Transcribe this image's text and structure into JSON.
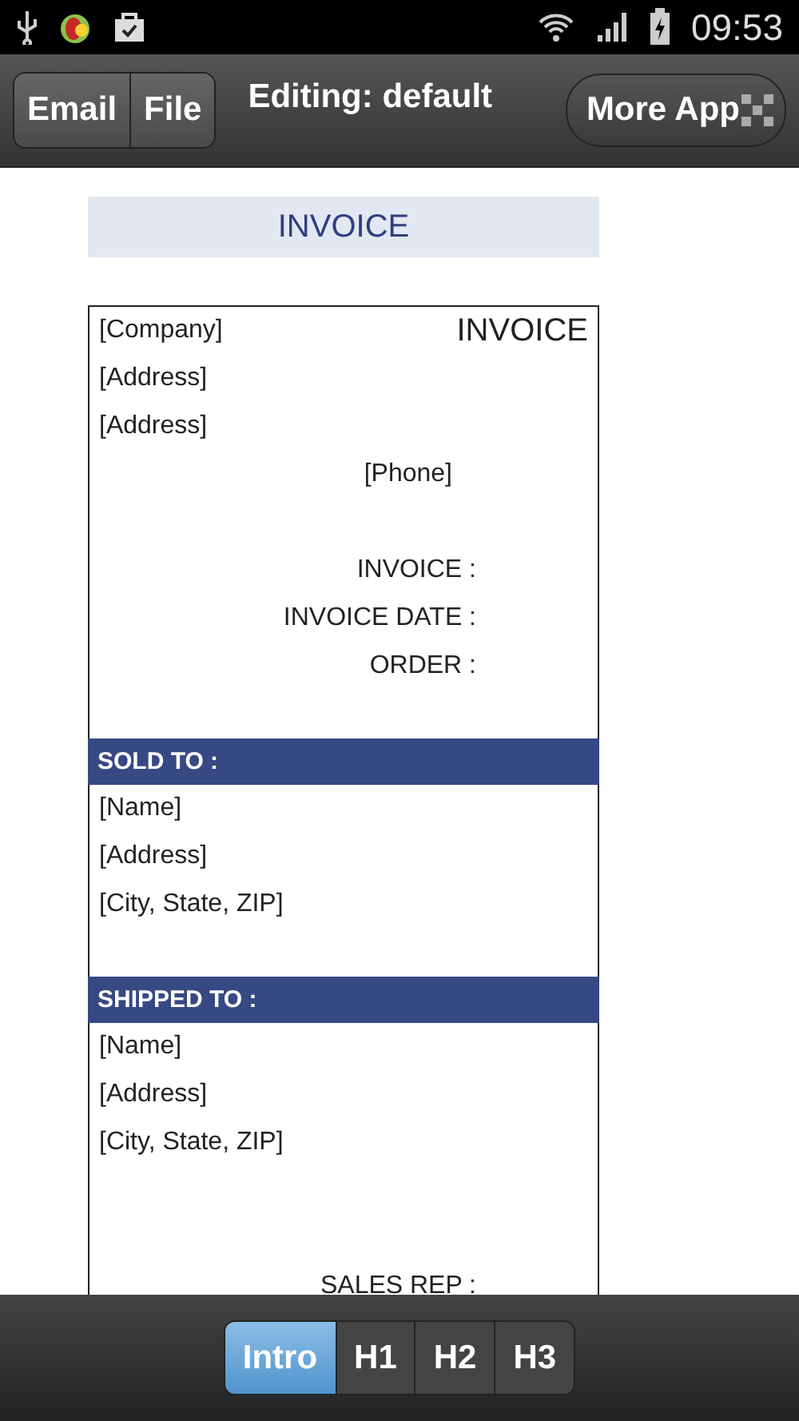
{
  "status_bar": {
    "time": "09:53"
  },
  "action_bar": {
    "buttons": [
      "Email",
      "File"
    ],
    "title": "Editing: default",
    "more_button": "More App"
  },
  "heading": "INVOICE",
  "document": {
    "company": "[Company]",
    "title": "INVOICE",
    "address_lines": [
      "[Address]",
      "[Address]"
    ],
    "phone": "[Phone]",
    "fields": [
      "INVOICE :",
      "INVOICE DATE :",
      "ORDER :"
    ],
    "sections": [
      {
        "title": "SOLD TO :",
        "lines": [
          "[Name]",
          "[Address]",
          "[City, State, ZIP]"
        ]
      },
      {
        "title": "SHIPPED TO :",
        "lines": [
          "[Name]",
          "[Address]",
          "[City, State, ZIP]"
        ]
      }
    ],
    "footer_fields": [
      "SALES REP :"
    ]
  },
  "tabs": [
    {
      "label": "Intro",
      "selected": true
    },
    {
      "label": "H1",
      "selected": false
    },
    {
      "label": "H2",
      "selected": false
    },
    {
      "label": "H3",
      "selected": false
    }
  ]
}
